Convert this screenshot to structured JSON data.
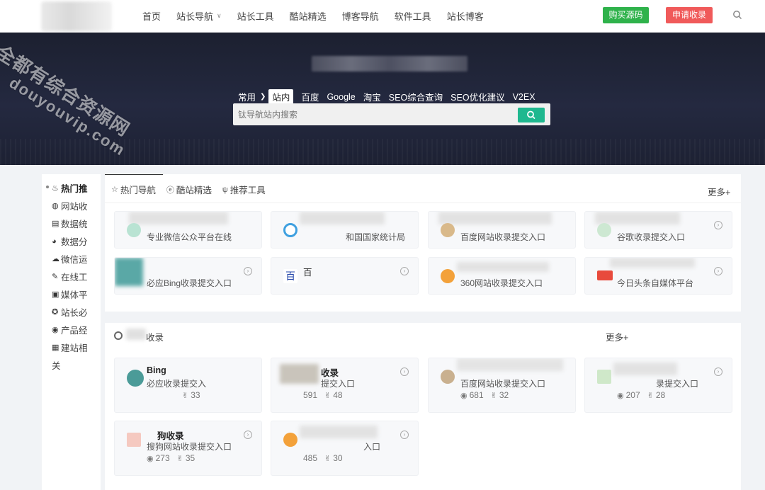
{
  "nav": {
    "items": [
      {
        "label": "首页"
      },
      {
        "label": "站长导航",
        "dropdown": true
      },
      {
        "label": "站长工具"
      },
      {
        "label": "酷站精选"
      },
      {
        "label": "博客导航"
      },
      {
        "label": "软件工具"
      },
      {
        "label": "站长博客"
      }
    ],
    "buy_label": "购买源码",
    "apply_label": "申请收录",
    "colors": {
      "buy": "#2fb24b",
      "apply": "#f05a5a"
    }
  },
  "hero": {
    "search_tabs": [
      "常用",
      "站内",
      "百度",
      "Google",
      "淘宝",
      "SEO综合查询",
      "SEO优化建议",
      "V2EX"
    ],
    "active_tab": "站内",
    "search_placeholder": "钛导航站内搜索",
    "search_button_color": "#1fb88f"
  },
  "sidebar": {
    "items": [
      {
        "label": "热门推",
        "icon": "fire-icon",
        "glyph": "♨"
      },
      {
        "label": "网站收",
        "icon": "globe-icon",
        "glyph": "◍"
      },
      {
        "label": "数据统",
        "icon": "chart-icon",
        "glyph": "▤"
      },
      {
        "label": "数据分",
        "icon": "pie-icon",
        "glyph": "◕"
      },
      {
        "label": "微信运",
        "icon": "wechat-icon",
        "glyph": "☁"
      },
      {
        "label": "在线工",
        "icon": "tool-icon",
        "glyph": "✎"
      },
      {
        "label": "媒体平",
        "icon": "media-icon",
        "glyph": "▣"
      },
      {
        "label": "站长必",
        "icon": "star-icon",
        "glyph": "✪"
      },
      {
        "label": "产品经",
        "icon": "product-icon",
        "glyph": "◉"
      },
      {
        "label": "建站相",
        "icon": "build-icon",
        "glyph": "▦"
      },
      {
        "label": "关",
        "icon": "",
        "glyph": ""
      }
    ]
  },
  "hot_panel": {
    "tabs": [
      {
        "label": "热门导航",
        "icon": "star-icon",
        "glyph": "☆"
      },
      {
        "label": "酷站精选",
        "icon": "ie-icon",
        "glyph": "ⓔ"
      },
      {
        "label": "推荐工具",
        "icon": "fork-icon",
        "glyph": "ψ"
      }
    ],
    "more_label": "更多+",
    "cards": [
      {
        "desc": "专业微信公众平台在线"
      },
      {
        "desc": "和国国家统计局"
      },
      {
        "desc": "百度网站收录提交入口"
      },
      {
        "desc": "谷歌收录提交入口"
      },
      {
        "desc": "必应Bing收录提交入口"
      },
      {
        "desc": "百"
      },
      {
        "desc": "360网站收录提交入口"
      },
      {
        "desc": "今日头条自媒体平台"
      }
    ]
  },
  "recent_panel": {
    "title": "收录",
    "more_label": "更多+",
    "cards": [
      {
        "title": "Bing",
        "desc": "必应收录提交入",
        "views": "",
        "likes": "33"
      },
      {
        "title": "收录",
        "desc": "提交入口",
        "views": "591",
        "likes": "48"
      },
      {
        "title": "",
        "desc": "百度网站收录提交入口",
        "views": "681",
        "likes": "32"
      },
      {
        "title": "",
        "desc": "录提交入口",
        "views": "207",
        "likes": "28"
      },
      {
        "title": "狗收录",
        "desc": "搜狗网站收录提交入口",
        "views": "273",
        "likes": "35"
      },
      {
        "title": "",
        "desc": "入口",
        "views": "485",
        "likes": "30"
      }
    ]
  },
  "watermark": {
    "line1": "全都有综合资源网",
    "line2": "douyouvip.com"
  }
}
